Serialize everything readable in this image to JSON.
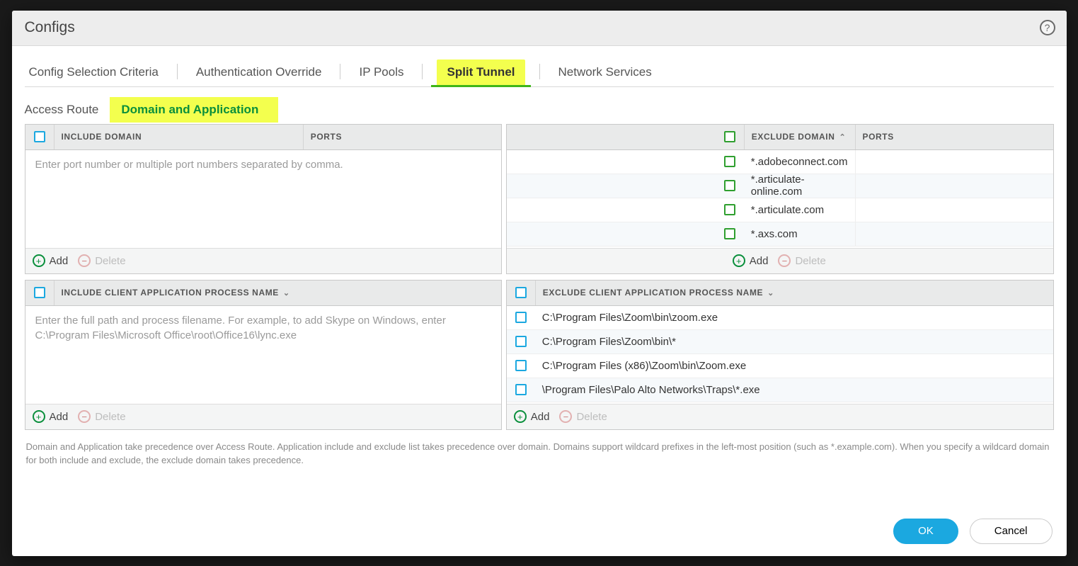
{
  "title": "Configs",
  "tabs": [
    "Config Selection Criteria",
    "Authentication Override",
    "IP Pools",
    "Split Tunnel",
    "Network Services"
  ],
  "tabs_active_index": 3,
  "subtabs": [
    "Access Route",
    "Domain and Application"
  ],
  "subtabs_active_index": 1,
  "include_domain": {
    "header": "INCLUDE DOMAIN",
    "ports_header": "PORTS",
    "placeholder": "Enter port number or multiple port numbers separated by comma.",
    "rows": []
  },
  "exclude_domain": {
    "header": "EXCLUDE DOMAIN",
    "ports_header": "PORTS",
    "sort": "asc",
    "rows": [
      {
        "domain": "*.adobeconnect.com",
        "ports": ""
      },
      {
        "domain": "*.articulate-online.com",
        "ports": ""
      },
      {
        "domain": "*.articulate.com",
        "ports": ""
      },
      {
        "domain": "*.axs.com",
        "ports": ""
      }
    ]
  },
  "include_app": {
    "header": "INCLUDE CLIENT APPLICATION PROCESS NAME",
    "placeholder": "Enter the full path and process filename. For example, to add Skype on Windows, enter C:\\Program Files\\Microsoft Office\\root\\Office16\\lync.exe",
    "rows": []
  },
  "exclude_app": {
    "header": "EXCLUDE CLIENT APPLICATION PROCESS NAME",
    "rows": [
      {
        "path": "C:\\Program Files\\Zoom\\bin\\zoom.exe"
      },
      {
        "path": "C:\\Program Files\\Zoom\\bin\\*"
      },
      {
        "path": "C:\\Program Files (x86)\\Zoom\\bin\\Zoom.exe"
      },
      {
        "path": "\\Program Files\\Palo Alto Networks\\Traps\\*.exe"
      }
    ]
  },
  "buttons": {
    "add": "Add",
    "delete": "Delete"
  },
  "note": "Domain and Application take precedence over Access Route. Application include and exclude list takes precedence over domain. Domains support wildcard prefixes in the left-most position (such as *.example.com). When you specify a wildcard domain for both include and exclude, the exclude domain takes precedence.",
  "footer": {
    "ok": "OK",
    "cancel": "Cancel"
  }
}
